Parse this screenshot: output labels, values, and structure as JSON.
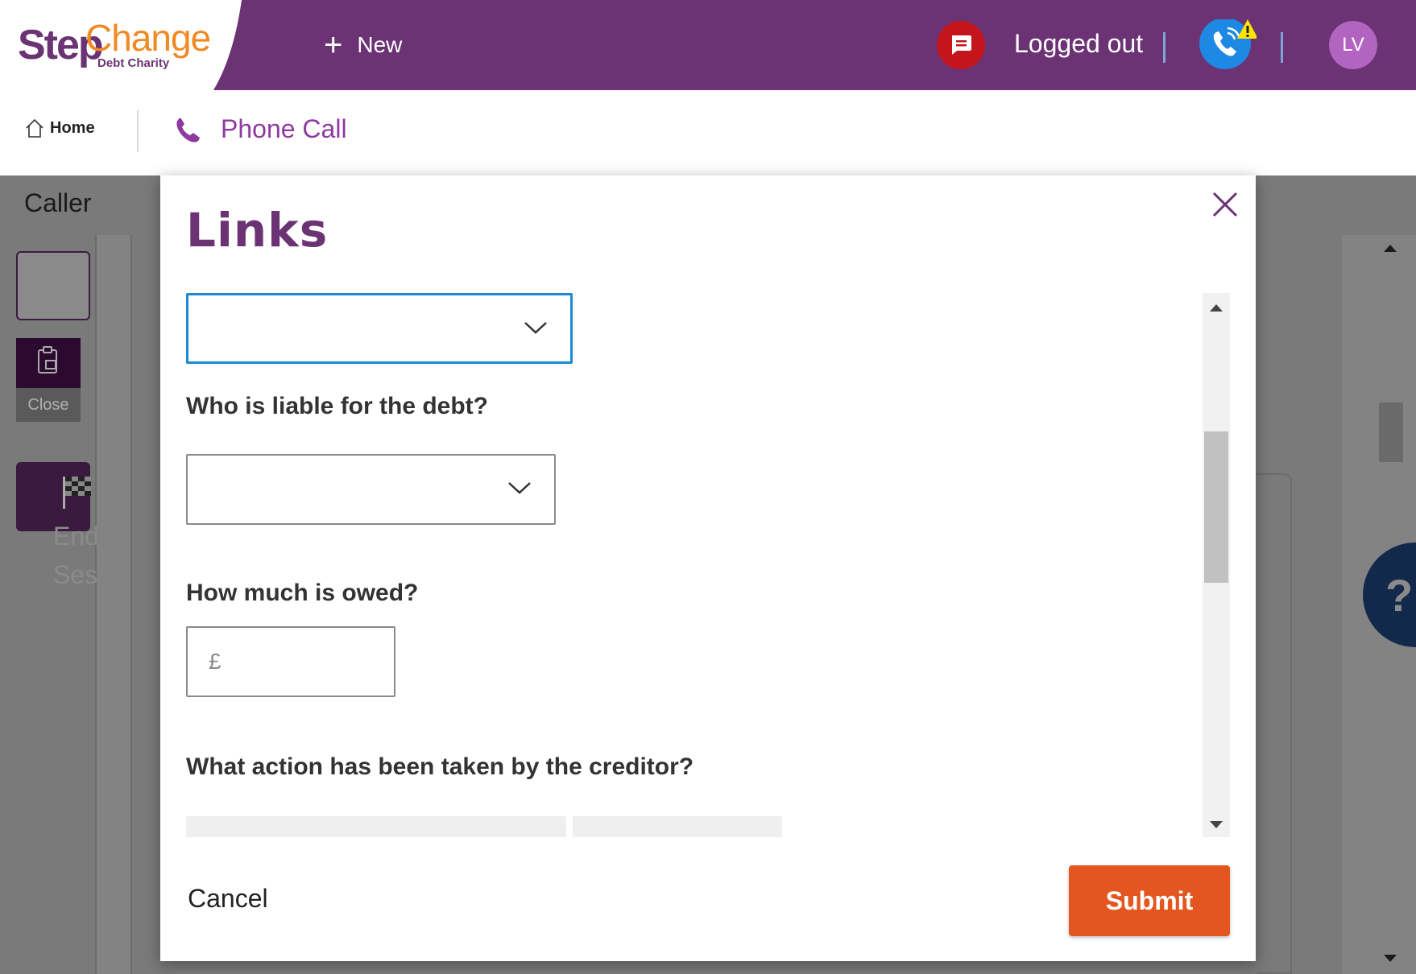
{
  "header": {
    "logo": {
      "main_left": "Step",
      "main_right": "Change",
      "sub": "Debt Charity"
    },
    "new_label": "New",
    "status_text": "Logged out",
    "avatar_initials": "LV",
    "colors": {
      "brand_purple": "#6b3374",
      "accent_orange": "#f08a24",
      "alert_red": "#c4151c",
      "phone_blue": "#1e88e5",
      "warning_yellow": "#ffe500"
    }
  },
  "breadcrumb": {
    "home_label": "Home",
    "current_label": "Phone Call"
  },
  "background": {
    "caller_label": "Caller",
    "close_label": "Close",
    "end_session_label": "End Session",
    "help_label": "?"
  },
  "modal": {
    "title": "Links",
    "first_select_value": "",
    "questions": {
      "liable": "Who is liable for the debt?",
      "owed": "How much is owed?",
      "action": "What action has been taken by the creditor?"
    },
    "liable_select_value": "",
    "owed_currency": "£",
    "owed_value": "",
    "cancel_label": "Cancel",
    "submit_label": "Submit",
    "submit_color": "#e4561f"
  }
}
